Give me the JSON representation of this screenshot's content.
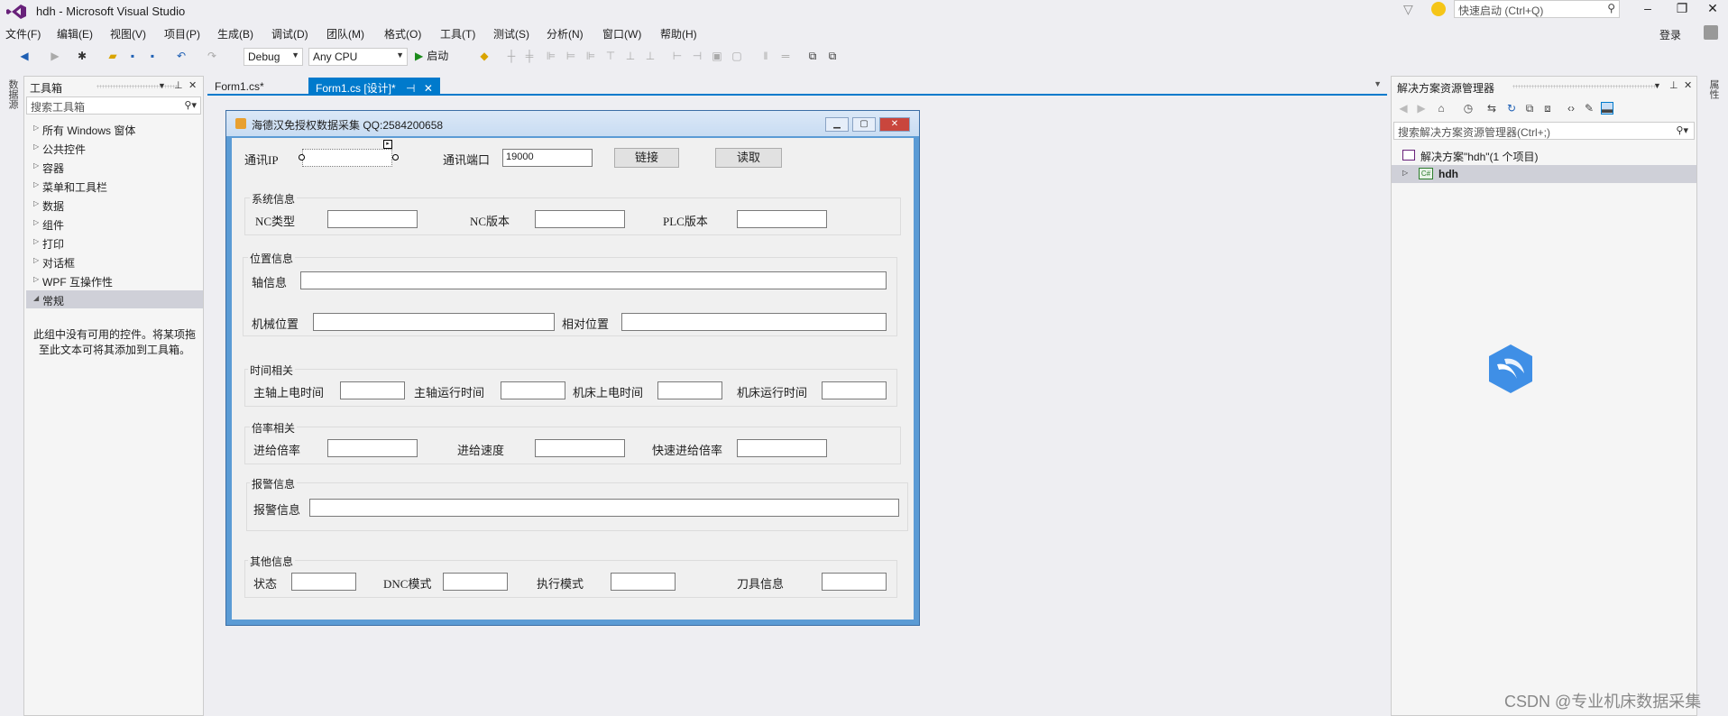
{
  "window": {
    "title": "hdh - Microsoft Visual Studio",
    "quick_launch_placeholder": "快速启动 (Ctrl+Q)",
    "login": "登录"
  },
  "menu": [
    "文件(F)",
    "编辑(E)",
    "视图(V)",
    "项目(P)",
    "生成(B)",
    "调试(D)",
    "团队(M)",
    "格式(O)",
    "工具(T)",
    "测试(S)",
    "分析(N)",
    "窗口(W)",
    "帮助(H)"
  ],
  "toolbar": {
    "config": "Debug",
    "platform": "Any CPU",
    "start": "启动"
  },
  "left_strip": {
    "label": "数据源"
  },
  "right_strip": {
    "label": "属性"
  },
  "toolbox": {
    "title": "工具箱",
    "search_placeholder": "搜索工具箱",
    "groups": [
      {
        "label": "所有 Windows 窗体",
        "expanded": false
      },
      {
        "label": "公共控件",
        "expanded": false
      },
      {
        "label": "容器",
        "expanded": false
      },
      {
        "label": "菜单和工具栏",
        "expanded": false
      },
      {
        "label": "数据",
        "expanded": false
      },
      {
        "label": "组件",
        "expanded": false
      },
      {
        "label": "打印",
        "expanded": false
      },
      {
        "label": "对话框",
        "expanded": false
      },
      {
        "label": "WPF 互操作性",
        "expanded": false
      },
      {
        "label": "常规",
        "expanded": true
      }
    ],
    "empty_message": "此组中没有可用的控件。将某项拖至此文本可将其添加到工具箱。"
  },
  "tabs": [
    {
      "label": "Form1.cs*",
      "active": false
    },
    {
      "label": "Form1.cs [设计]*",
      "active": true
    }
  ],
  "form": {
    "title": "海德汉免授权数据采集 QQ:2584200658",
    "comm_ip_label": "通讯IP",
    "comm_ip_value": "",
    "comm_port_label": "通讯端口",
    "comm_port_value": "19000",
    "connect_button": "链接",
    "read_button": "读取",
    "system_info": {
      "title": "系统信息",
      "nc_type": "NC类型",
      "nc_version": "NC版本",
      "plc_version": "PLC版本"
    },
    "position_info": {
      "title": "位置信息",
      "axis_info": "轴信息",
      "machine_pos": "机械位置",
      "relative_pos": "相对位置"
    },
    "time_info": {
      "title": "时间相关",
      "spindle_power_time": "主轴上电时间",
      "spindle_run_time": "主轴运行时间",
      "machine_power_time": "机床上电时间",
      "machine_run_time": "机床运行时间"
    },
    "rate_info": {
      "title": "倍率相关",
      "feed_rate": "进给倍率",
      "feed_speed": "进给速度",
      "rapid_rate": "快速进给倍率"
    },
    "alarm_info": {
      "title": "报警信息",
      "alarm_label": "报警信息"
    },
    "other_info": {
      "title": "其他信息",
      "status": "状态",
      "dnc_mode": "DNC模式",
      "exec_mode": "执行模式",
      "tool_info": "刀具信息"
    }
  },
  "solution_explorer": {
    "title": "解决方案资源管理器",
    "search_placeholder": "搜索解决方案资源管理器(Ctrl+;)",
    "root": "解决方案\"hdh\"(1 个项目)",
    "project": "hdh"
  },
  "watermark": "CSDN @专业机床数据采集",
  "colors": {
    "accent": "#007acc",
    "background": "#eeeef2",
    "form_border": "#5b9bd5"
  }
}
